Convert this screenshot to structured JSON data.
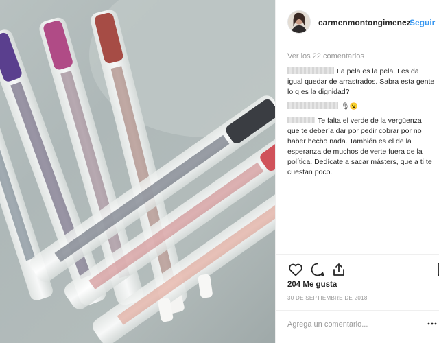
{
  "post": {
    "username": "carmenmontongimenez",
    "separator": "•",
    "follow_label": "Seguir"
  },
  "comments_section": {
    "view_all_label": "Ver los 22 comentarios",
    "comments": [
      {
        "text": "La pela es la pela. Les da igual quedar de arrastrados. Sabra esta gente lo q es la dignidad?"
      },
      {
        "text": "",
        "emoji": "🎙😮"
      },
      {
        "text": "Te falta el verde de la vergüenza que te debería dar por pedir cobrar por no haber hecho nada. También es el de la esperanza de muchos de verte fuera de la política. Dedícate a sacar másters, que a ti te cuestan poco."
      }
    ]
  },
  "actions": {
    "like_icon": "heart-outline-icon",
    "comment_icon": "speech-bubble-icon",
    "share_icon": "share-upload-icon",
    "save_icon": "bookmark-icon"
  },
  "likes_label": "204 Me gusta",
  "date_label": "30 DE SEPTIEMBRE DE 2018",
  "add_comment": {
    "placeholder": "Agrega un comentario...",
    "more_icon": "ellipsis-icon"
  },
  "photo": {
    "subject": "pens-on-table-photo"
  },
  "colors": {
    "link_blue": "#3897f0",
    "text_dark": "#262626",
    "text_muted": "#999999",
    "border": "#efefef"
  }
}
